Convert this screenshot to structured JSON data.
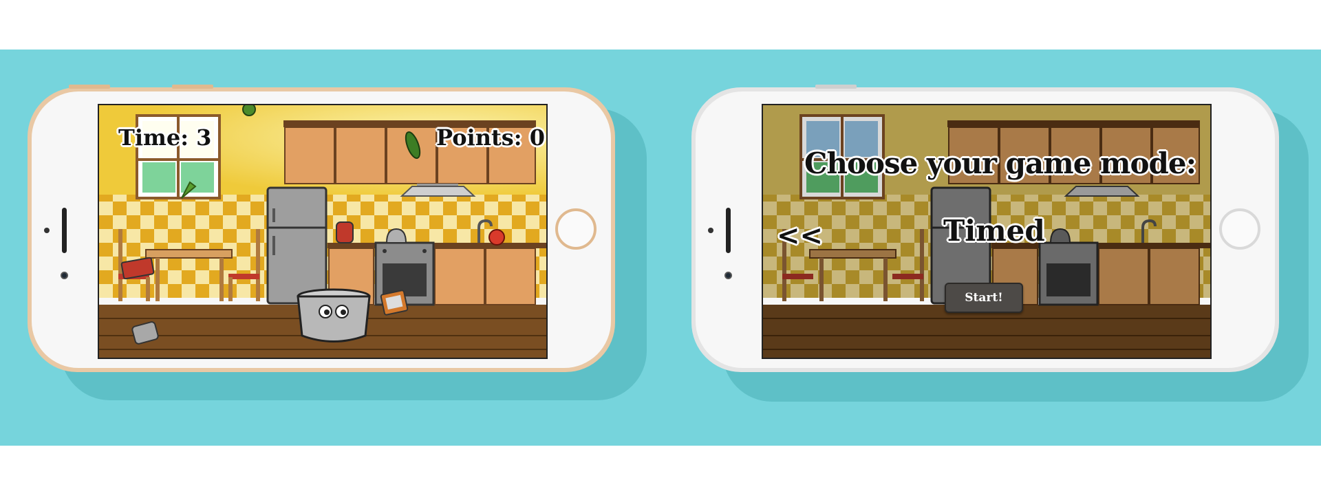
{
  "colors": {
    "background_band": "#76d4dc",
    "phone_gold": "#e9c8a4",
    "phone_silver": "#e4e4e4",
    "wall_yellow": "#f1cf45",
    "floor_brown": "#7a4e22",
    "start_button": "#4d4a47"
  },
  "gameplay_screen": {
    "time_label": "Time: 3",
    "points_label": "Points: 0",
    "player_character": "pot-with-eyes-icon",
    "falling_items": [
      "pepper-icon",
      "carrot-icon",
      "broccoli-icon",
      "tomato-icon",
      "toaster-icon",
      "tv-icon"
    ]
  },
  "menu_screen": {
    "heading": "Choose your game mode:",
    "previous_arrow": "<<",
    "mode_label": "Timed",
    "start_button_label": "Start!"
  }
}
